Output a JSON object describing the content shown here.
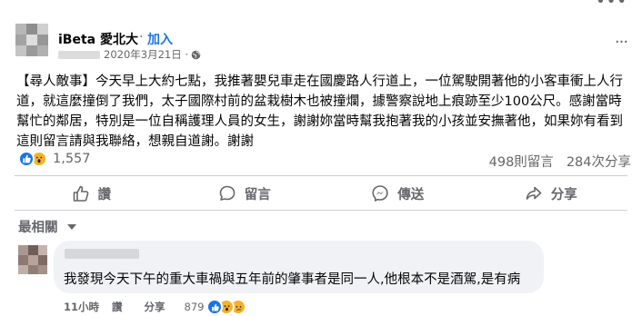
{
  "post": {
    "page_name": "iBeta 愛北大",
    "separator": "·",
    "join_label": "加入",
    "date": "2020年3月21日 ·",
    "body": "【尋人敵事】今天早上大約七點，我推著嬰兒車走在國慶路人行道上，一位駕駛開著他的小客車衝上人行道，就這麼撞倒了我們，太子國際村前的盆栽樹木也被撞爛，據警察說地上痕跡至少100公尺。感謝當時幫忙的鄰居，特別是一位自稱護理人員的女生，謝謝妳當時幫我抱著我的小孩並安撫著他，如果妳有看到這則留言請與我聯絡，想親自道謝。謝謝",
    "more_icon": "···"
  },
  "stats": {
    "reaction_count": "1,557",
    "comments": "498則留言",
    "shares": "284次分享"
  },
  "actions": {
    "like": "讚",
    "comment": "留言",
    "send": "傳送",
    "share": "分享"
  },
  "comments_section": {
    "sort_label": "最相關",
    "comment": {
      "text": "我發現今天下午的重大車禍與五年前的肇事者是同一人,他根本不是酒駕,是有病",
      "time": "11小時",
      "like": "讚",
      "share": "分享",
      "reaction_count": "879"
    }
  },
  "colors": {
    "accent": "#1b74e4",
    "secondary_text": "#65676b",
    "bubble": "#f0f2f5",
    "divider": "#ced0d4",
    "wow": "#f7b125"
  }
}
